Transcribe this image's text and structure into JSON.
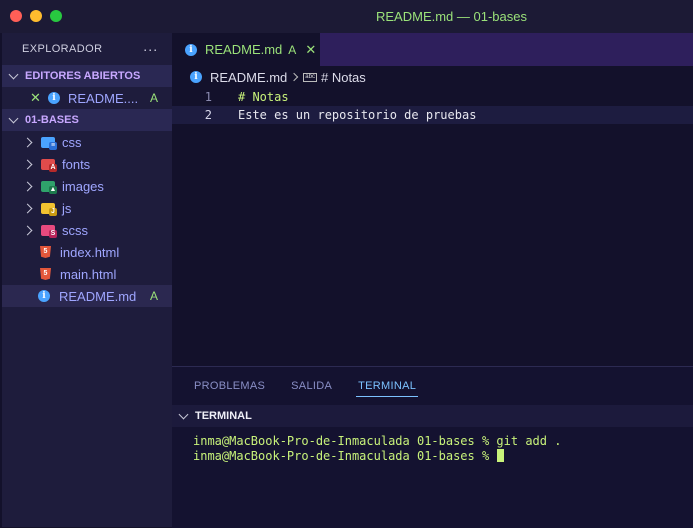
{
  "window": {
    "title": "README.md — 01-bases"
  },
  "sidebar": {
    "explorer_label": "EXPLORADOR",
    "more_label": "···",
    "open_editors": {
      "label": "EDITORES ABIERTOS",
      "items": [
        {
          "name": "README....",
          "badge": "A"
        }
      ]
    },
    "folder": {
      "label": "01-BASES",
      "folders": [
        {
          "name": "css",
          "color": "#4aa3ff"
        },
        {
          "name": "fonts",
          "color": "#e04b4b"
        },
        {
          "name": "images",
          "color": "#2fa36b"
        },
        {
          "name": "js",
          "color": "#f2c230"
        },
        {
          "name": "scss",
          "color": "#e84a7f"
        }
      ],
      "files": [
        {
          "name": "index.html",
          "badge": ""
        },
        {
          "name": "main.html",
          "badge": ""
        },
        {
          "name": "README.md",
          "badge": "A"
        }
      ]
    }
  },
  "editor": {
    "tab": {
      "label": "README.md",
      "badge": "A"
    },
    "breadcrumb": {
      "file": "README.md",
      "symbol": "# Notas"
    },
    "lines": [
      {
        "num": "1",
        "text": "# Notas"
      },
      {
        "num": "2",
        "text": "Este es un repositorio de pruebas"
      }
    ]
  },
  "panel": {
    "tabs": [
      "PROBLEMAS",
      "SALIDA",
      "TERMINAL"
    ],
    "active_tab": "TERMINAL",
    "section_label": "TERMINAL",
    "terminal_lines": [
      "inma@MacBook-Pro-de-Inmaculada 01-bases % git add .",
      "inma@MacBook-Pro-de-Inmaculada 01-bases % "
    ]
  }
}
